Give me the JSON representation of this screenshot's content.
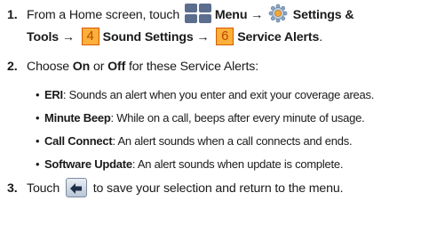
{
  "steps": [
    {
      "number": "1.",
      "line1": {
        "pre": "From a Home screen, touch ",
        "menu": "Menu",
        "arrow1": " → ",
        "settings_a": "Settings &"
      },
      "line2": {
        "settings_b": "Tools",
        "arrow2": " → ",
        "key1": "4",
        "sound": "Sound Settings",
        "arrow3": " → ",
        "key2": "6",
        "service": "Service Alerts",
        "end": "."
      }
    },
    {
      "number": "2.",
      "pre": "Choose ",
      "on": "On",
      "or": " or ",
      "off": "Off",
      "post": " for these Service Alerts:"
    },
    {
      "number": "3.",
      "pre": "Touch ",
      "post": " to save your selection and return to the menu."
    }
  ],
  "bullets": [
    {
      "term": "ERI",
      "desc": ": Sounds an alert when you enter and exit your coverage areas."
    },
    {
      "term": "Minute Beep",
      "desc": ": While on a call, beeps after every minute of usage."
    },
    {
      "term": "Call Connect",
      "desc": ": An alert sounds when a call connects and ends."
    },
    {
      "term": "Software Update",
      "desc": ": An alert sounds when update is complete."
    }
  ],
  "icons": {
    "menu": "menu-grid-icon",
    "settings": "gear-icon",
    "back": "back-arrow-icon"
  },
  "colors": {
    "text": "#1a1a1a",
    "menu_icon": "#5b6e8e",
    "key_fill": "#fbb03b",
    "key_border": "#d85a00"
  }
}
